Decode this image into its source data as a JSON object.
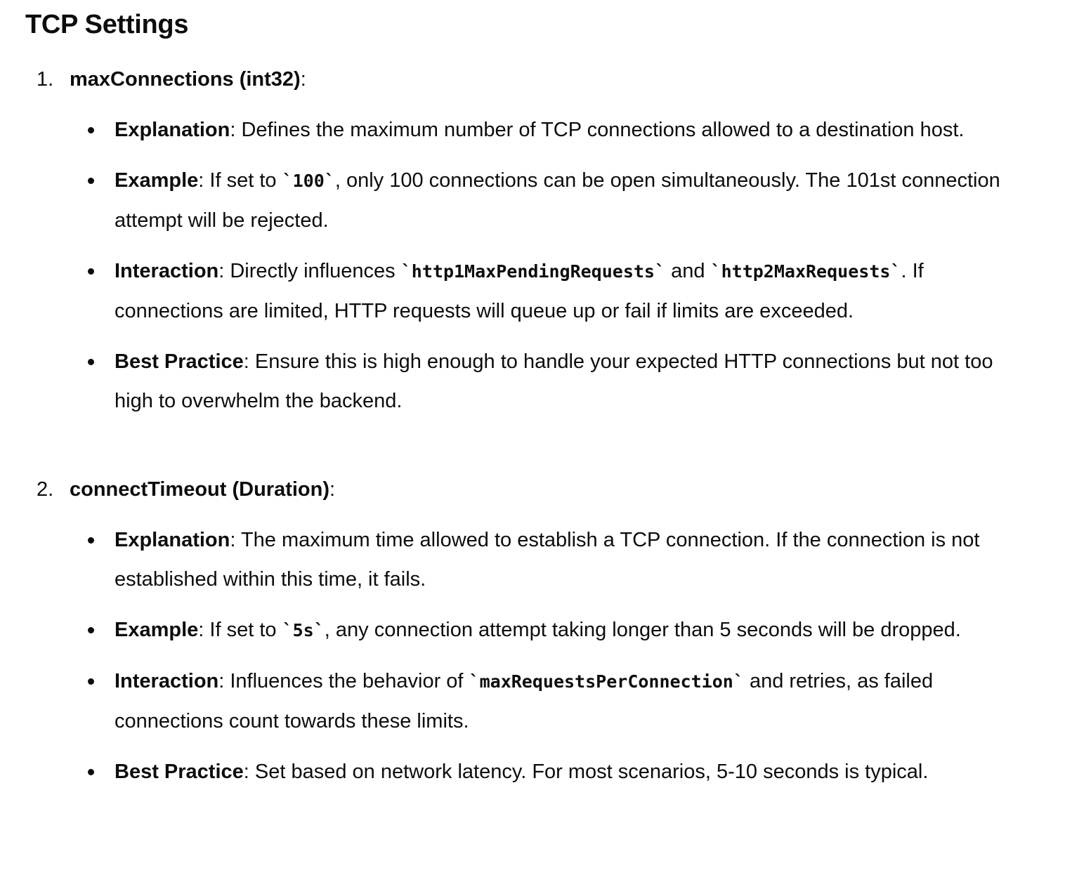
{
  "title": "TCP Settings",
  "items": [
    {
      "number": "1.",
      "name": "maxConnections (int32)",
      "suffix": ":",
      "bullets": [
        {
          "label": "Explanation",
          "parts": [
            {
              "t": ": Defines the maximum number of TCP connections allowed to a destination host."
            }
          ]
        },
        {
          "label": "Example",
          "parts": [
            {
              "t": ": If set to "
            },
            {
              "c": "`100`"
            },
            {
              "t": ", only 100 connections can be open simultaneously. The 101st connection attempt will be rejected."
            }
          ]
        },
        {
          "label": "Interaction",
          "parts": [
            {
              "t": ": Directly influences "
            },
            {
              "c": "`http1MaxPendingRequests`"
            },
            {
              "t": " and "
            },
            {
              "c": "`http2MaxRequests`"
            },
            {
              "t": ". If connections are limited, HTTP requests will queue up or fail if limits are exceeded."
            }
          ]
        },
        {
          "label": "Best Practice",
          "parts": [
            {
              "t": ": Ensure this is high enough to handle your expected HTTP connections but not too high to overwhelm the backend."
            }
          ]
        }
      ]
    },
    {
      "number": "2.",
      "name": "connectTimeout (Duration)",
      "suffix": ":",
      "bullets": [
        {
          "label": "Explanation",
          "parts": [
            {
              "t": ": The maximum time allowed to establish a TCP connection. If the connection is not established within this time, it fails."
            }
          ]
        },
        {
          "label": "Example",
          "parts": [
            {
              "t": ": If set to "
            },
            {
              "c": "`5s`"
            },
            {
              "t": ", any connection attempt taking longer than 5 seconds will be dropped."
            }
          ]
        },
        {
          "label": "Interaction",
          "parts": [
            {
              "t": ": Influences the behavior of "
            },
            {
              "c": "`maxRequestsPerConnection`"
            },
            {
              "t": " and retries, as failed connections count towards these limits."
            }
          ]
        },
        {
          "label": "Best Practice",
          "parts": [
            {
              "t": ": Set based on network latency. For most scenarios, 5-10 seconds is typical."
            }
          ]
        }
      ]
    }
  ]
}
